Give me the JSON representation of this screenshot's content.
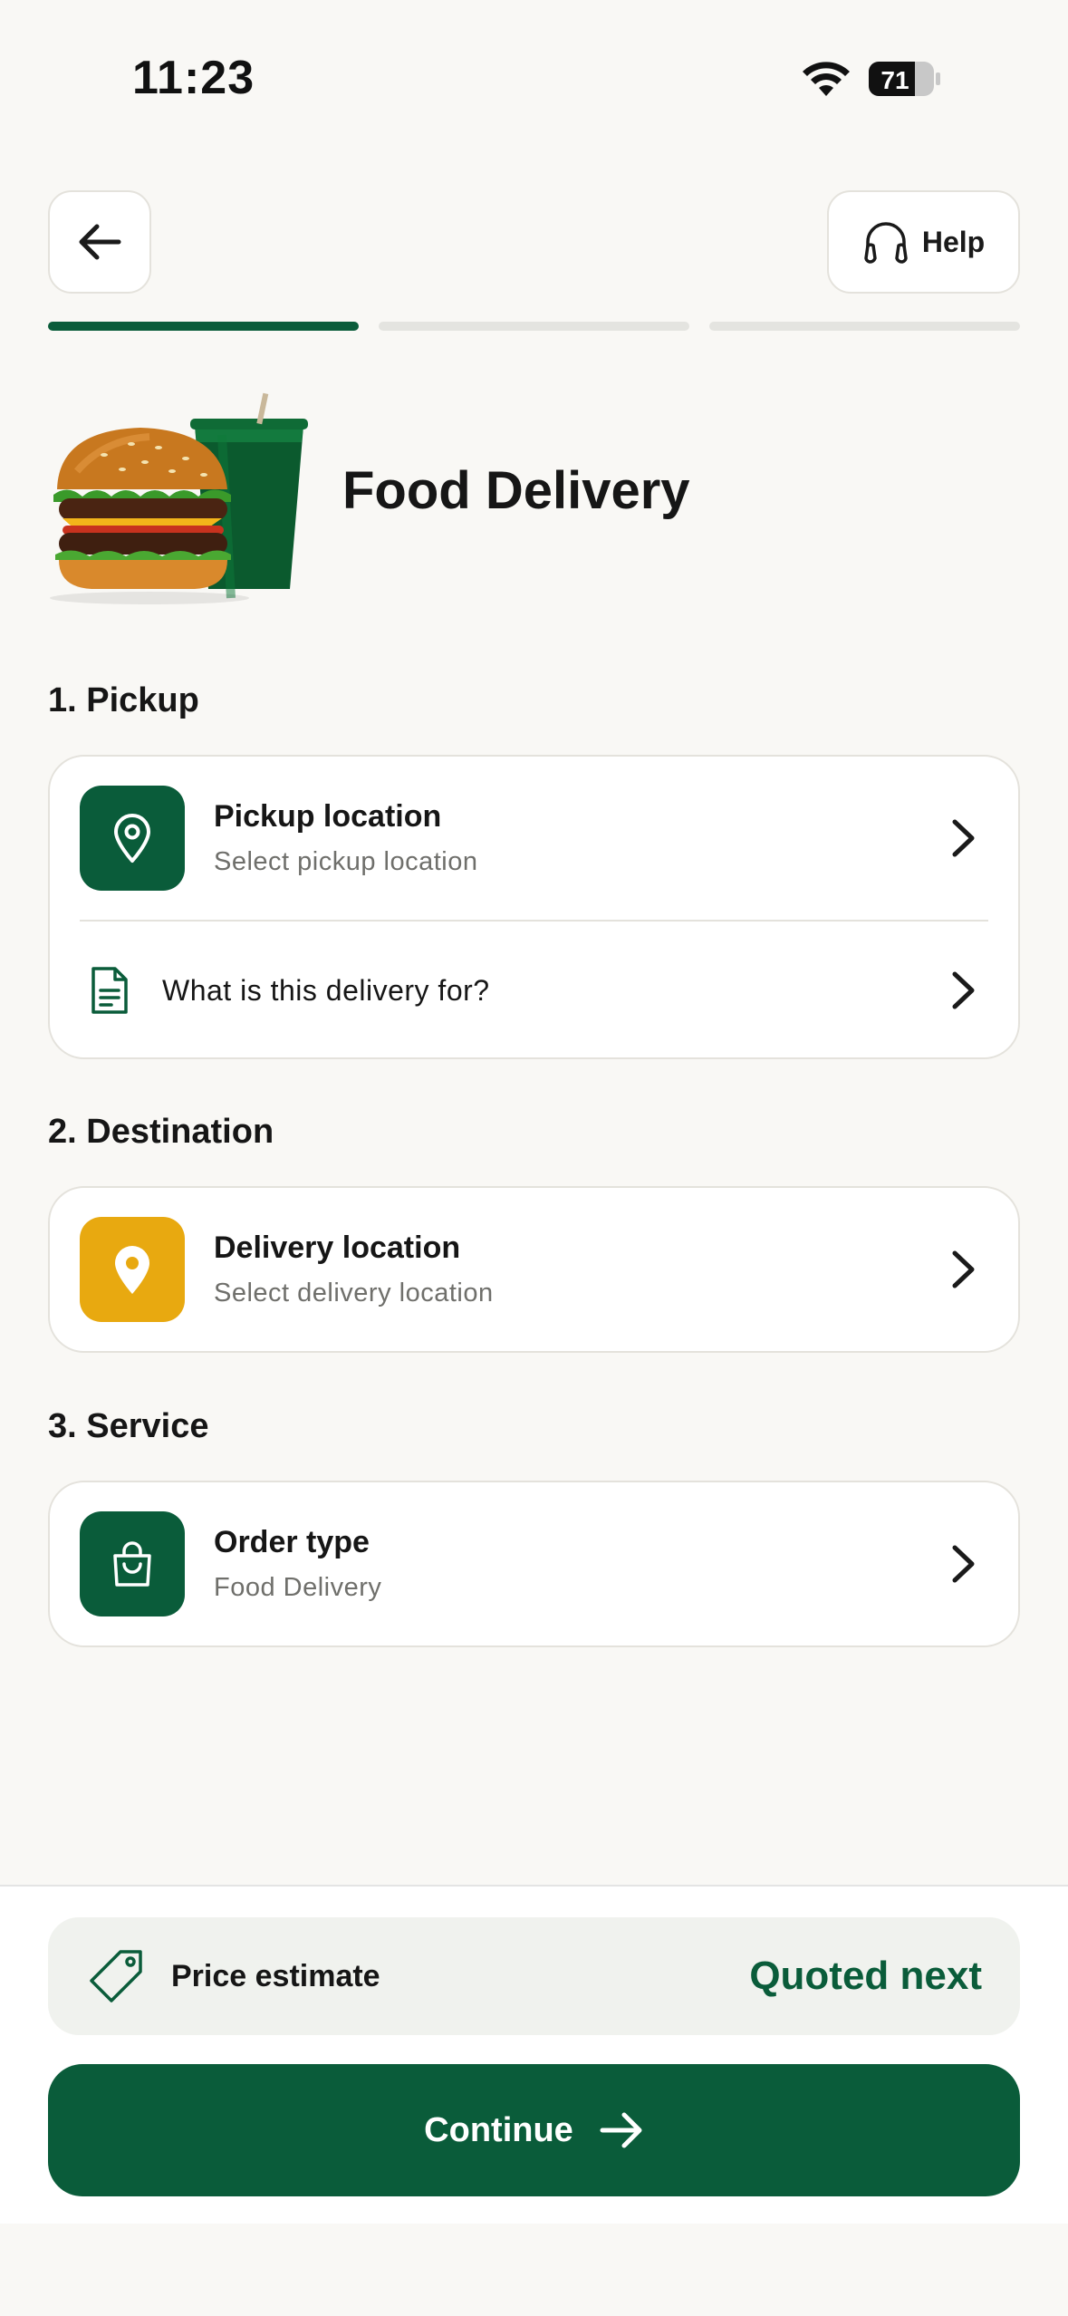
{
  "status_bar": {
    "time": "11:23",
    "battery": "71"
  },
  "header": {
    "help_label": "Help"
  },
  "progress": {
    "total_steps": 3,
    "current_step": 1
  },
  "page": {
    "title": "Food Delivery"
  },
  "sections": {
    "pickup": {
      "heading": "1. Pickup",
      "location_title": "Pickup location",
      "location_sub": "Select pickup location",
      "purpose_label": "What is this delivery for?"
    },
    "destination": {
      "heading": "2. Destination",
      "location_title": "Delivery location",
      "location_sub": "Select delivery location"
    },
    "service": {
      "heading": "3. Service",
      "order_title": "Order type",
      "order_sub": "Food Delivery"
    }
  },
  "footer": {
    "price_label": "Price estimate",
    "price_value": "Quoted next",
    "continue_label": "Continue"
  },
  "colors": {
    "brand_green": "#0a5c3a",
    "accent_yellow": "#e8a910",
    "background": "#f9f8f5"
  }
}
